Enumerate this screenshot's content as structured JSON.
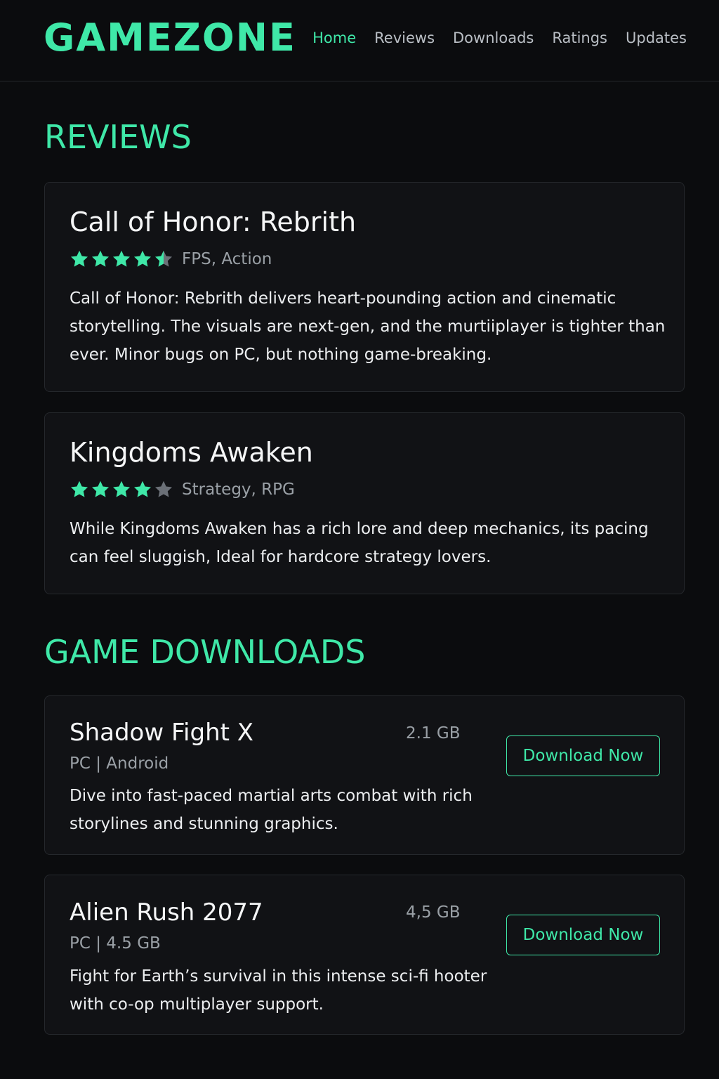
{
  "brand": {
    "logo_text": "GAMEZONE",
    "accent_color": "#3fe8a8"
  },
  "nav": {
    "items": [
      {
        "label": "Home",
        "active": true
      },
      {
        "label": "Reviews",
        "active": false
      },
      {
        "label": "Downloads",
        "active": false
      },
      {
        "label": "Ratings",
        "active": false
      },
      {
        "label": "Updates",
        "active": false
      }
    ]
  },
  "reviews": {
    "section_title": "REVIEWS",
    "items": [
      {
        "title": "Call of Honor: Rebrith",
        "rating": 4.5,
        "rating_max": 5,
        "genre": "FPS, Action",
        "text": "Call of Honor: Rebrith delivers heart-pounding action and cinematic storytelling. The visuals are next-gen, and the murtiiplayer is tighter than ever. Minor bugs on PC, but nothing game-breaking."
      },
      {
        "title": "Kingdoms Awaken",
        "rating": 4,
        "rating_max": 5,
        "genre": "Strategy, RPG",
        "text": "While Kingdoms Awaken has a rich lore and deep mechanics, its pacing can feel sluggish, Ideal for hardcore strategy lovers."
      }
    ]
  },
  "downloads": {
    "section_title": "GAME DOWNLOADS",
    "items": [
      {
        "title": "Shadow Fight X",
        "size": "2.1 GB",
        "platform": "PC | Android",
        "description": "Dive into fast-paced martial arts combat with rich storylines and stunning graphics.",
        "button_label": "Download Now"
      },
      {
        "title": "Alien Rush 2077",
        "size": "4,5 GB",
        "platform": "PC | 4.5 GB",
        "description": "Fight for Earth’s survival in this intense sci-fi hooter with co-op multiplayer support.",
        "button_label": "Download Now"
      }
    ]
  }
}
